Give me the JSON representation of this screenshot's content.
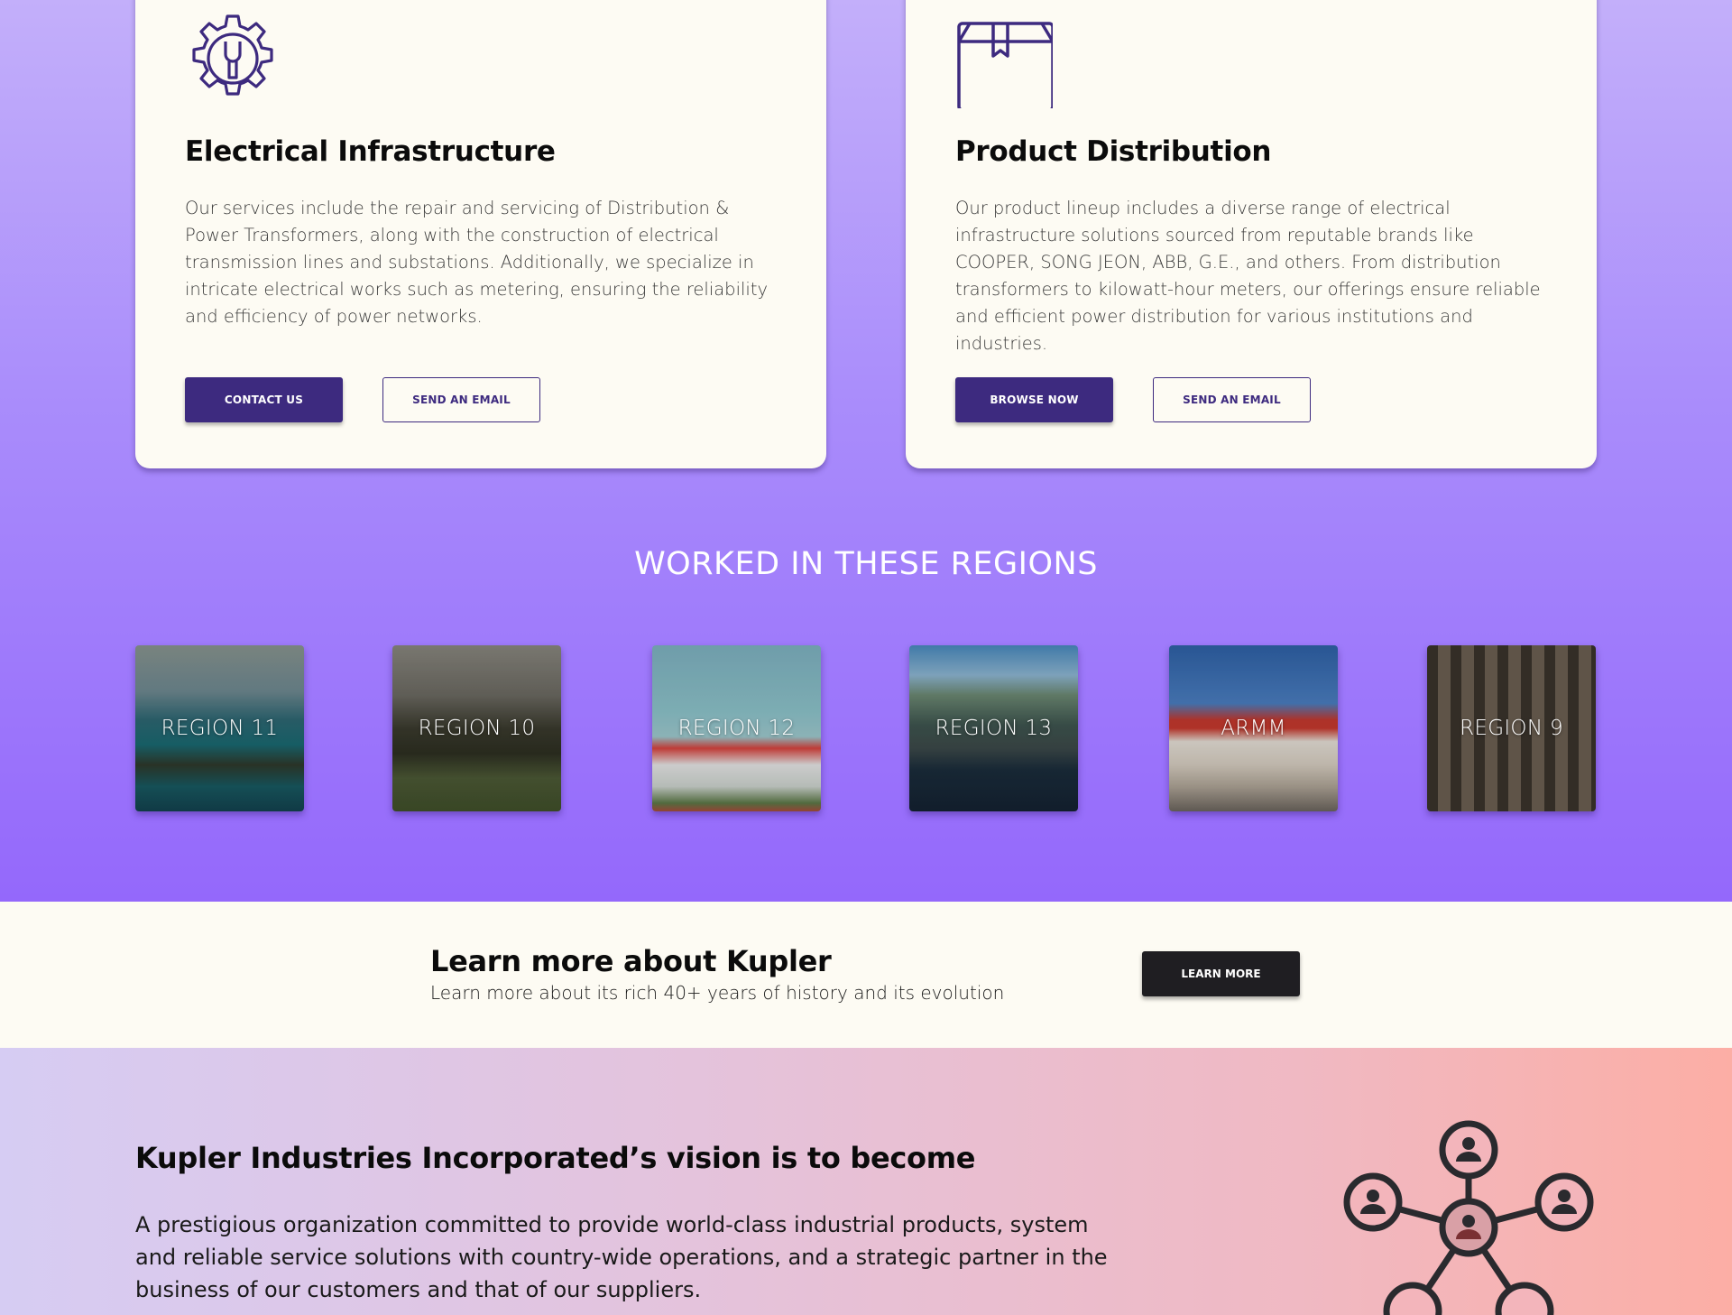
{
  "services": {
    "electrical": {
      "icon": "gear-wrench-icon",
      "title": "Electrical Infrastructure",
      "description": "Our services include the repair and servicing of Distribution & Power Transformers, along with the construction of electrical transmission lines and substations. Additionally, we specialize in intricate electrical works such as metering, ensuring the reliability and efficiency of power networks.",
      "primary_label": "CONTACT US",
      "secondary_label": "SEND AN EMAIL"
    },
    "distribution": {
      "icon": "box-icon",
      "title": "Product Distribution",
      "description": "Our product lineup includes a diverse range of electrical infrastructure solutions sourced from reputable brands like COOPER, SONG JEON, ABB, G.E., and others. From distribution transformers to kilowatt-hour meters, our offerings ensure reliable and efficient power distribution for various institutions and industries.",
      "primary_label": "BROWSE NOW",
      "secondary_label": "SEND AN EMAIL"
    }
  },
  "regions": {
    "title": "WORKED IN THESE REGIONS",
    "items": [
      {
        "label": "REGION 11"
      },
      {
        "label": "REGION 10"
      },
      {
        "label": "REGION 12"
      },
      {
        "label": "REGION 13"
      },
      {
        "label": "ARMM"
      },
      {
        "label": "REGION 9"
      }
    ]
  },
  "learn": {
    "title": "Learn more about Kupler",
    "subtitle": "Learn more about its rich 40+ years of history and its evolution",
    "button_label": "LEARN MORE"
  },
  "vision": {
    "title": "Kupler Industries Incorporated’s vision is to become",
    "body": "A prestigious organization committed to provide world-class industrial products, system and reliable service solutions with country-wide operations, and a strategic partner in the business of our customers and that of our suppliers.",
    "icon": "people-network-icon"
  },
  "colors": {
    "accent": "#3d2a7f",
    "dark_button": "#1f1e22",
    "card_bg": "#fdfbf3",
    "gradient_top": "#c3affa",
    "gradient_bottom": "#9468fb"
  }
}
